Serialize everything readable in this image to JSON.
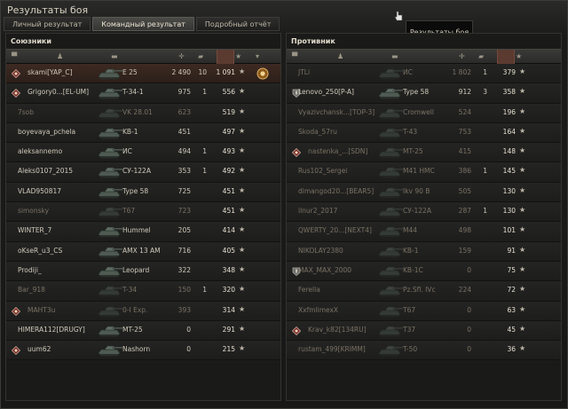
{
  "window": {
    "title": "Результаты боя"
  },
  "tabs": [
    {
      "label": "Личный результат"
    },
    {
      "label": "Командный результат"
    },
    {
      "label": "Подробный отчёт"
    }
  ],
  "tooltip": {
    "text": "Результаты боя"
  },
  "allies": {
    "title": "Союзники",
    "rows": [
      {
        "name": "skami[YAP_C]",
        "vehicle": "E 25",
        "damage": "2 490",
        "kills": "10",
        "xp": "1 091",
        "self": true,
        "alive": true,
        "platoon": true,
        "medal": true
      },
      {
        "name": "Grigory0...[EL-UM]",
        "vehicle": "T-34-1",
        "damage": "975",
        "kills": "1",
        "xp": "556",
        "alive": true,
        "platoon": true
      },
      {
        "name": "7sob",
        "vehicle": "VK 28.01",
        "damage": "623",
        "kills": "",
        "xp": "519",
        "alive": false
      },
      {
        "name": "boyevaya_pchela",
        "vehicle": "KB-1",
        "damage": "451",
        "kills": "",
        "xp": "497",
        "alive": true
      },
      {
        "name": "aleksannemo",
        "vehicle": "ИС",
        "damage": "494",
        "kills": "1",
        "xp": "493",
        "alive": true
      },
      {
        "name": "Aleks0107_2015",
        "vehicle": "СУ-122А",
        "damage": "353",
        "kills": "1",
        "xp": "492",
        "alive": true
      },
      {
        "name": "VLAD950817",
        "vehicle": "Type 58",
        "damage": "725",
        "kills": "",
        "xp": "451",
        "alive": true
      },
      {
        "name": "simonsky",
        "vehicle": "T67",
        "damage": "723",
        "kills": "",
        "xp": "451",
        "alive": false
      },
      {
        "name": "WINTER_7",
        "vehicle": "Hummel",
        "damage": "205",
        "kills": "",
        "xp": "414",
        "alive": true
      },
      {
        "name": "oKseR_u3_CS",
        "vehicle": "AMX 13 AM",
        "damage": "716",
        "kills": "",
        "xp": "405",
        "alive": true
      },
      {
        "name": "Prodiji_",
        "vehicle": "Leopard",
        "damage": "322",
        "kills": "",
        "xp": "348",
        "alive": true
      },
      {
        "name": "Bar_918",
        "vehicle": "T-34",
        "damage": "150",
        "kills": "1",
        "xp": "320",
        "alive": false
      },
      {
        "name": "MAHT3u",
        "vehicle": "0-I Exp.",
        "damage": "393",
        "kills": "",
        "xp": "314",
        "alive": false,
        "platoon": true
      },
      {
        "name": "HIMERA112[DRUGY]",
        "vehicle": "MT-25",
        "damage": "0",
        "kills": "",
        "xp": "291",
        "alive": true
      },
      {
        "name": "uum62",
        "vehicle": "Nashorn",
        "damage": "0",
        "kills": "",
        "xp": "215",
        "alive": true,
        "platoon": true
      }
    ]
  },
  "enemies": {
    "title": "Противник",
    "rows": [
      {
        "name": "JTLi",
        "vehicle": "ИС",
        "damage": "1 802",
        "kills": "1",
        "xp": "379",
        "alive": false
      },
      {
        "name": "Lenovo_250[P-A]",
        "vehicle": "Type 58",
        "damage": "912",
        "kills": "3",
        "xp": "358",
        "alive": true,
        "shield": true
      },
      {
        "name": "Vyazivchansk...[TOP-3]",
        "vehicle": "Cromwell",
        "damage": "524",
        "kills": "",
        "xp": "196",
        "alive": false
      },
      {
        "name": "Skoda_57ru",
        "vehicle": "T-43",
        "damage": "753",
        "kills": "",
        "xp": "164",
        "alive": false
      },
      {
        "name": "nastenka_...[SDN]",
        "vehicle": "MT-25",
        "damage": "415",
        "kills": "",
        "xp": "148",
        "alive": false,
        "platoon": true
      },
      {
        "name": "Rus102_Sergei",
        "vehicle": "M41 HMC",
        "damage": "386",
        "kills": "1",
        "xp": "145",
        "alive": false
      },
      {
        "name": "dimangod20...[BEAR5]",
        "vehicle": "Ikv 90 B",
        "damage": "505",
        "kills": "",
        "xp": "130",
        "alive": false
      },
      {
        "name": "ilnur2_2017",
        "vehicle": "СУ-122А",
        "damage": "287",
        "kills": "1",
        "xp": "130",
        "alive": false
      },
      {
        "name": "QWERTY_20...[NEXT4]",
        "vehicle": "M44",
        "damage": "498",
        "kills": "",
        "xp": "101",
        "alive": false
      },
      {
        "name": "NIKOLAY2380",
        "vehicle": "KB-1",
        "damage": "159",
        "kills": "",
        "xp": "91",
        "alive": false
      },
      {
        "name": "MAX_MAX_2000",
        "vehicle": "KB-1C",
        "damage": "0",
        "kills": "",
        "xp": "75",
        "alive": false,
        "shield": true
      },
      {
        "name": "Ferella",
        "vehicle": "Pz.Sfl. IVc",
        "damage": "224",
        "kills": "",
        "xp": "72",
        "alive": false
      },
      {
        "name": "XxfmlimexX",
        "vehicle": "T67",
        "damage": "0",
        "kills": "",
        "xp": "63",
        "alive": false
      },
      {
        "name": "Krav_k82[134RU]",
        "vehicle": "T37",
        "damage": "0",
        "kills": "",
        "xp": "45",
        "alive": false,
        "platoon": true
      },
      {
        "name": "rustam_499[KRIMM]",
        "vehicle": "T-50",
        "damage": "0",
        "kills": "",
        "xp": "36",
        "alive": false
      }
    ]
  },
  "colors": {
    "self_row": "#3d2a22",
    "accent": "#5b3a30",
    "dead_text": "#7a7263"
  },
  "icons": {
    "platoon": "diamond-platoon-icon",
    "shield": "shield-icon",
    "star": "star-icon",
    "medal": "medal-icon"
  }
}
